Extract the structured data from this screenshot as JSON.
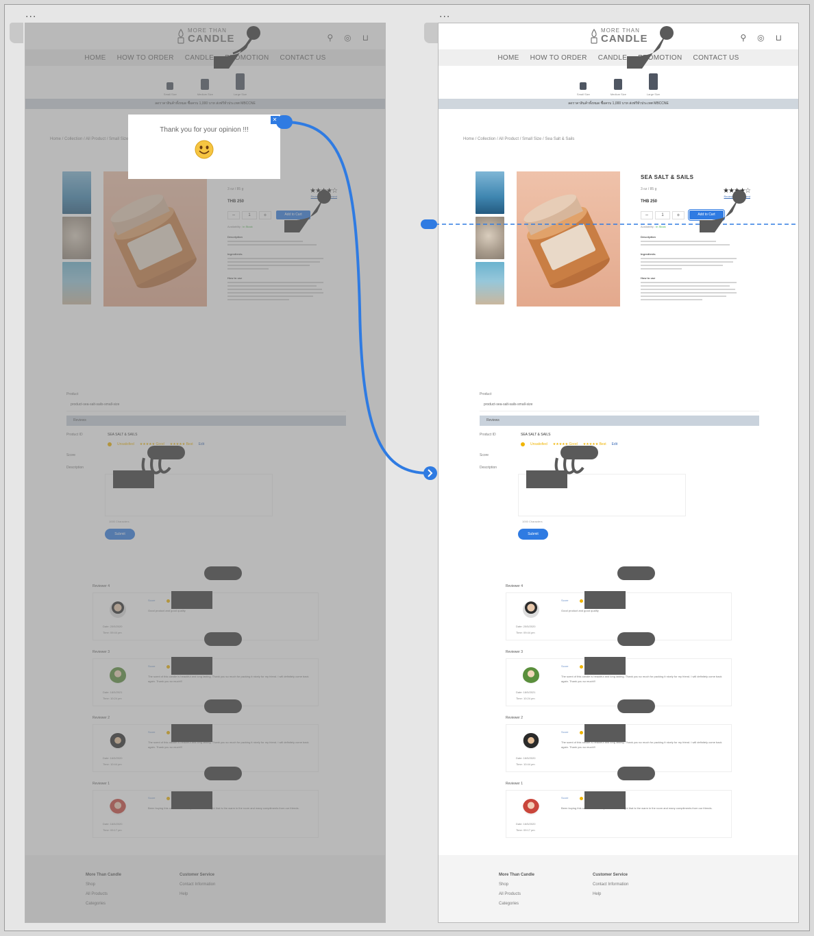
{
  "board": {
    "dots_left": "...",
    "dots_right": "..."
  },
  "store": {
    "logo_small": "MORE THAN",
    "logo_big": "CANDLE",
    "nav": [
      "HOME",
      "HOW TO ORDER",
      "CANDLE",
      "PROMOTION",
      "CONTACT US"
    ],
    "sizes": [
      "Small Size",
      "Medium Size",
      "Large Size"
    ],
    "promo": "ลดราคาสินค้าทั้งหมด ซื้อครบ 1,000 บาท ส่งฟรีทั่วประเทศ MBCCNE",
    "breadcrumb": "Home / Collection / All Product / Small Size / Sea Salt & Sails",
    "product_title": "SEA SALT & SAILS",
    "product_meta": "3 oz / 85 g",
    "product_stars": "★★★★☆",
    "reviews_link": "Review and comment",
    "product_price": "THB 250",
    "qty_minus": "−",
    "qty_value": "1",
    "qty_plus": "+",
    "add_to_cart": "Add to Cart",
    "availability_label": "Availability :",
    "availability_value": "In Stock",
    "sec1": "Description",
    "sec2": "Ingredients",
    "sec3": "How to use",
    "form_label": "Product",
    "form_input": "product-sea-salt-sails-small-size",
    "form_bar": "Reviews",
    "form_product_label": "Product ID",
    "form_product_value": "SEA SALT & SAILS",
    "form_rating_label": "Score",
    "form_comment_label": "Description",
    "form_star_opts": [
      "Unsatisfied",
      "★★★★★ Good",
      "★★★★★ Best"
    ],
    "form_star_link": "Edit",
    "char_count": "1000 Characters",
    "submit": "Submit",
    "reviews": [
      {
        "title": "Reviewer 4",
        "score": "Score",
        "date": "Date: 20/5/2020",
        "time": "Time: 09:44 pm",
        "text": "Good product and good quality"
      },
      {
        "title": "Reviewer 3",
        "score": "Score",
        "date": "Date: 18/5/2021",
        "time": "Time: 10:24 pm",
        "text": "The scent of this candle is beautiful and long lasting. Thank you so much for packing it nicely for my friend. I will definitely come back again. Thank you so much!!!"
      },
      {
        "title": "Reviewer 2",
        "score": "Score",
        "date": "Date: 16/5/2020",
        "time": "Time: 10:44 pm",
        "text": "The scent of this candle is beautiful and long lasting. Thank you so much for packing it nicely for my friend. I will definitely come back again. Thank you so much!!!"
      },
      {
        "title": "Reviewer 1",
        "score": "Score",
        "date": "Date: 16/5/2020",
        "time": "Time: 09:17 pm",
        "text": "Been buying this candle for over 4 years. Beautiful light that is the warm in the room and many compliments from our friends."
      }
    ],
    "footer_col1": [
      "More Than Candle",
      "Shop",
      "All Products",
      "Categories"
    ],
    "footer_col2": [
      "Customer Service",
      "Contact Information",
      "Help"
    ]
  },
  "popup": {
    "text": "Thank you for your opinion !!!",
    "close": "✕"
  },
  "colors": {
    "accent": "#2f7be2",
    "overlay": "#7a7a7a",
    "hand": "#5a5a5a"
  }
}
